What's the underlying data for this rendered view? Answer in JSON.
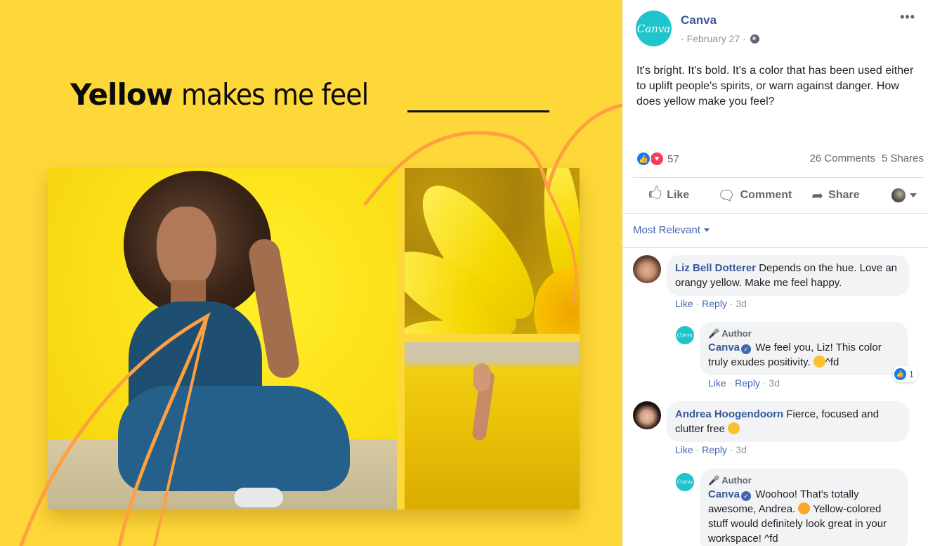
{
  "image": {
    "headline_bold": "Yellow",
    "headline_rest": "makes me feel",
    "background_color": "#FED739",
    "accent_color": "#FFA040"
  },
  "post": {
    "page_name": "Canva",
    "avatar_text": "Canva",
    "date": "February 27",
    "separator": "·",
    "more_icon": "•••",
    "text": "It's bright. It's bold. It's a color that has been used either to uplift people's spirits, or warn against danger. How does yellow make you feel?",
    "reaction_count": "57",
    "comments_count": "26 Comments",
    "shares_count": "5 Shares",
    "brand_color": "#20C4CB",
    "link_color": "#385898"
  },
  "actions": {
    "like": "Like",
    "comment": "Comment",
    "share": "Share"
  },
  "sort": {
    "label": "Most Relevant"
  },
  "comments": [
    {
      "author": "Liz Bell Dotterer",
      "text": "Depends on the hue. Love an orangy yellow. Make me feel happy.",
      "like": "Like",
      "reply": "Reply",
      "time": "3d",
      "reply_item": {
        "tag": "Author",
        "author": "Canva",
        "text_before": "We feel you, Liz! This color truly exudes positivity.",
        "text_after": "^fd",
        "emoji": "smiling-face-icon",
        "like": "Like",
        "reply": "Reply",
        "time": "3d",
        "reaction_count": "1"
      }
    },
    {
      "author": "Andrea Hoogendoorn",
      "text": "Fierce, focused and clutter free",
      "emoji": "upside-down-face-icon",
      "like": "Like",
      "reply": "Reply",
      "time": "3d",
      "reply_item": {
        "tag": "Author",
        "author": "Canva",
        "text_before": "Woohoo! That's totally awesome, Andrea.",
        "text_after": "Yellow-colored stuff would definitely look great in your workspace! ^fd",
        "emoji": "star-struck-icon"
      }
    }
  ]
}
